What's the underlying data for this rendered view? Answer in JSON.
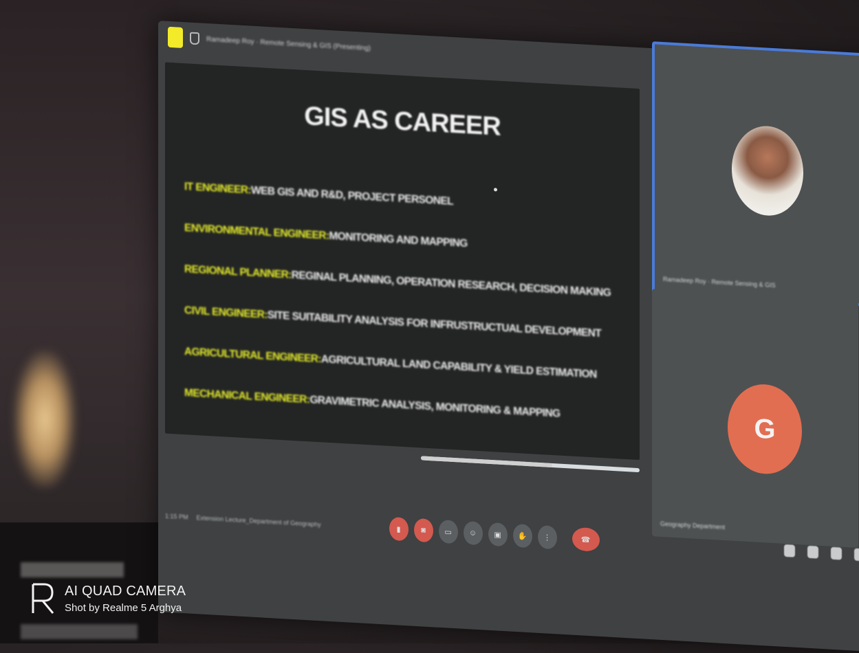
{
  "meeting": {
    "title": "Ramadeep Roy · Remote Sensing & GIS (Presenting)",
    "footer_time": "1:15 PM",
    "footer_name": "Extension Lecture_Department of Geography"
  },
  "slide": {
    "title": "GIS AS CAREER",
    "bullets": [
      {
        "role": "IT ENGINEER:",
        "desc": " WEB GIS AND R&D, PROJECT PERSONEL"
      },
      {
        "role": "ENVIRONMENTAL ENGINEER:",
        "desc": " MONITORING AND MAPPING"
      },
      {
        "role": "REGIONAL PLANNER:",
        "desc": " REGINAL PLANNING, OPERATION RESEARCH, DECISION MAKING"
      },
      {
        "role": "CIVIL ENGINEER:",
        "desc": " SITE SUITABILITY ANALYSIS FOR INFRUSTRUCTUAL DEVELOPMENT"
      },
      {
        "role": "AGRICULTURAL ENGINEER:",
        "desc": " AGRICULTURAL LAND CAPABILITY & YIELD ESTIMATION"
      },
      {
        "role": "MECHANICAL ENGINEER:",
        "desc": " GRAVIMETRIC ANALYSIS, MONITORING & MAPPING"
      }
    ],
    "scroll_progress": 0.6
  },
  "participants": [
    {
      "name": "Ramadeep Roy · Remote Sensing & GIS",
      "avatar": "photo"
    },
    {
      "name": "Geography Department",
      "avatar_letter": "G",
      "avatar_color": "#e26e51"
    }
  ],
  "controls": {
    "accent_red": "#d4594f",
    "icons": [
      "mic-off-icon",
      "camera-off-icon",
      "captions-icon",
      "emoji-icon",
      "present-icon",
      "raise-hand-icon",
      "more-icon",
      "end-call-icon"
    ],
    "right_icons": [
      "info-icon",
      "people-icon",
      "chat-icon",
      "activities-icon"
    ]
  },
  "watermark": {
    "line1": "AI QUAD CAMERA",
    "line2": "Shot by Realme 5 Arghya"
  }
}
